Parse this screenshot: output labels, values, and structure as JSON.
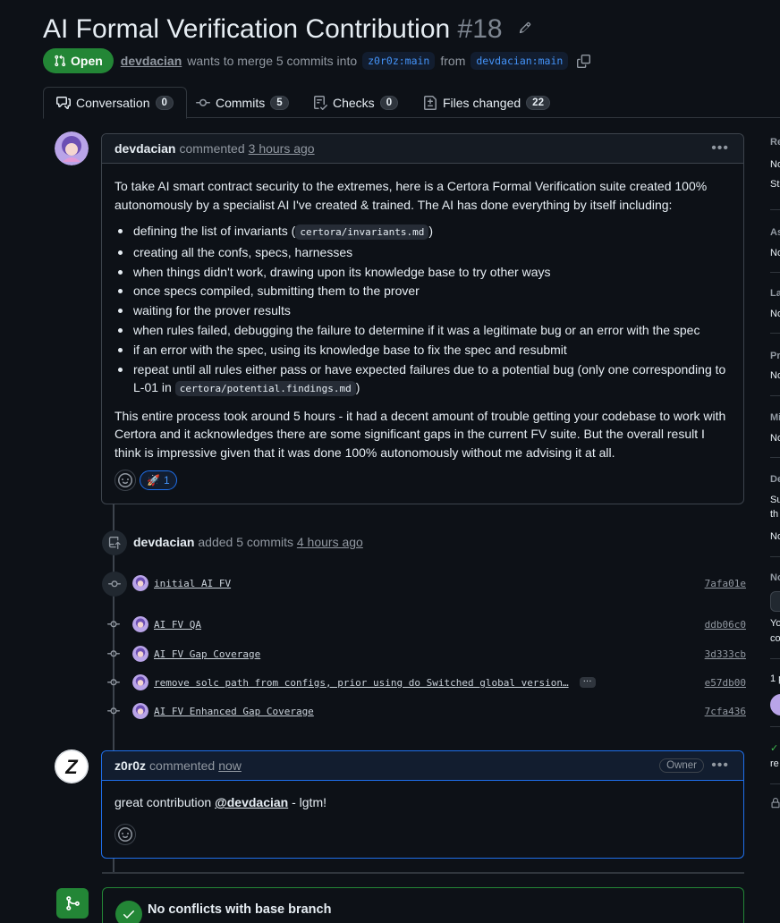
{
  "header": {
    "title": "AI Formal Verification Contribution",
    "number": "#18",
    "status": "Open",
    "author": "devdacian",
    "merge_text": "wants to merge 5 commits into",
    "base_branch": "z0r0z:main",
    "from_text": "from",
    "head_branch": "devdacian:main"
  },
  "tabs": [
    {
      "label": "Conversation",
      "count": "0"
    },
    {
      "label": "Commits",
      "count": "5"
    },
    {
      "label": "Checks",
      "count": "0"
    },
    {
      "label": "Files changed",
      "count": "22"
    }
  ],
  "comment1": {
    "author": "devdacian",
    "action": "commented",
    "time": "3 hours ago",
    "intro": "To take AI smart contract security to the extremes, here is a Certora Formal Verification suite created 100% autonomously by a specialist AI I've created & trained. The AI has done everything by itself including:",
    "bullets": {
      "b1_pre": "defining the list of invariants (",
      "b1_code": "certora/invariants.md",
      "b1_post": ")",
      "b2": "creating all the confs, specs, harnesses",
      "b3": "when things didn't work, drawing upon its knowledge base to try other ways",
      "b4": "once specs compiled, submitting them to the prover",
      "b5": "waiting for the prover results",
      "b6": "when rules failed, debugging the failure to determine if it was a legitimate bug or an error with the spec",
      "b7": "if an error with the spec, using its knowledge base to fix the spec and resubmit",
      "b8_pre": "repeat until all rules either pass or have expected failures due to a potential bug (only one corresponding to L-01 in",
      "b8_code": "certora/potential.findings.md",
      "b8_post": ")"
    },
    "outro": "This entire process took around 5 hours - it had a decent amount of trouble getting your codebase to work with Certora and it acknowledges there are some significant gaps in the current FV suite. But the overall result I think is impressive given that it was done 100% autonomously without me advising it at all.",
    "reaction_emoji": "🚀",
    "reaction_count": "1"
  },
  "commit_event": {
    "author": "devdacian",
    "action": "added 5 commits",
    "time": "4 hours ago"
  },
  "commits": [
    {
      "message": "initial AI FV",
      "sha": "7afa01e"
    },
    {
      "message": "AI FV QA",
      "sha": "ddb06c0"
    },
    {
      "message": "AI FV Gap Coverage",
      "sha": "3d333cb"
    },
    {
      "message": "remove solc path from configs, prior using do Switched global version…",
      "sha": "e57db00",
      "more": "···"
    },
    {
      "message": "AI FV Enhanced Gap Coverage",
      "sha": "7cfa436"
    }
  ],
  "comment2": {
    "author": "z0r0z",
    "action": "commented",
    "time": "now",
    "badge": "Owner",
    "text_pre": "great contribution",
    "mention": "@devdacian",
    "text_post": "- lgtm!"
  },
  "merge": {
    "title": "No conflicts with base branch"
  },
  "sidebar": {
    "r": "Re",
    "no1": "No",
    "st": "St",
    "as": "As",
    "no2": "No",
    "la": "La",
    "no3": "No",
    "pr": "Pr",
    "no4": "No",
    "mi": "Mi",
    "no5": "No",
    "de": "De",
    "su": "Su",
    "th": "th",
    "no6": "No",
    "nt": "No",
    "yo": "Yo",
    "co": "co",
    "one": "1 p",
    "re": "re"
  },
  "colors": {
    "background": "#0d1117",
    "open_green": "#238636",
    "link_blue": "#4493f8",
    "border": "#3d444d"
  }
}
